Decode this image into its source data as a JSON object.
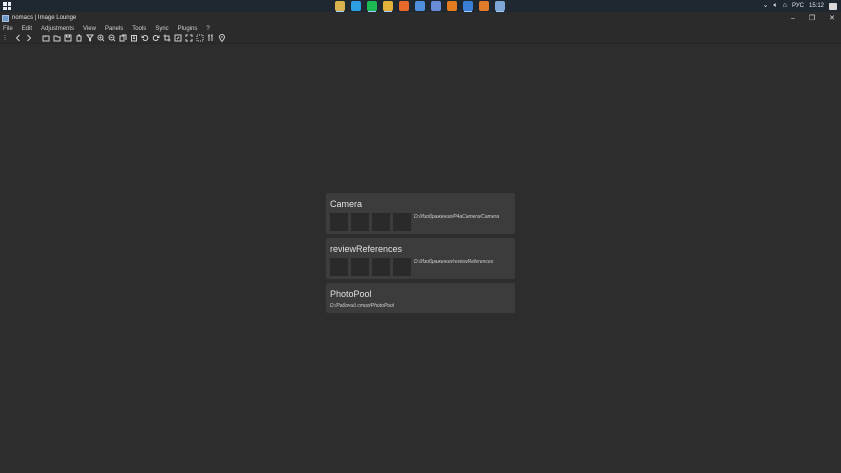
{
  "taskbar": {
    "apps": [
      {
        "name": "file-explorer-icon",
        "color": "#d9b34d",
        "active": true
      },
      {
        "name": "telegram-icon",
        "color": "#2b9fe0",
        "active": false
      },
      {
        "name": "spotify-icon",
        "color": "#1db954",
        "active": true
      },
      {
        "name": "chrome-icon",
        "color": "#e2b23a",
        "active": true
      },
      {
        "name": "firefox-icon",
        "color": "#e86a2a",
        "active": false
      },
      {
        "name": "pen-app-icon",
        "color": "#4f8fdc",
        "active": false
      },
      {
        "name": "paint-icon",
        "color": "#6a8bd8",
        "active": false
      },
      {
        "name": "blender-icon",
        "color": "#e37b1f",
        "active": false
      },
      {
        "name": "feather-icon",
        "color": "#3a7fd6",
        "active": true
      },
      {
        "name": "tool-icon",
        "color": "#e07b2a",
        "active": false
      },
      {
        "name": "nomacs-icon",
        "color": "#7ea6d6",
        "active": true
      }
    ],
    "tray": {
      "language": "РУС",
      "time": "15:12"
    }
  },
  "window": {
    "title": "nomacs | Image Lounge"
  },
  "menu": [
    "File",
    "Edit",
    "Adjustments",
    "View",
    "Panels",
    "Tools",
    "Sync",
    "Plugins",
    "?"
  ],
  "recent": [
    {
      "title": "Camera",
      "path": "D:/Изображения/P4aCamera/Camera",
      "thumbs": 4
    },
    {
      "title": "reviewReferences",
      "path": "D:/Изображения/reviewReferences",
      "thumbs": 4
    },
    {
      "title": "PhotoPool",
      "path": "D:/Рабочий стол/PhotoPool",
      "thumbs": 0
    }
  ]
}
